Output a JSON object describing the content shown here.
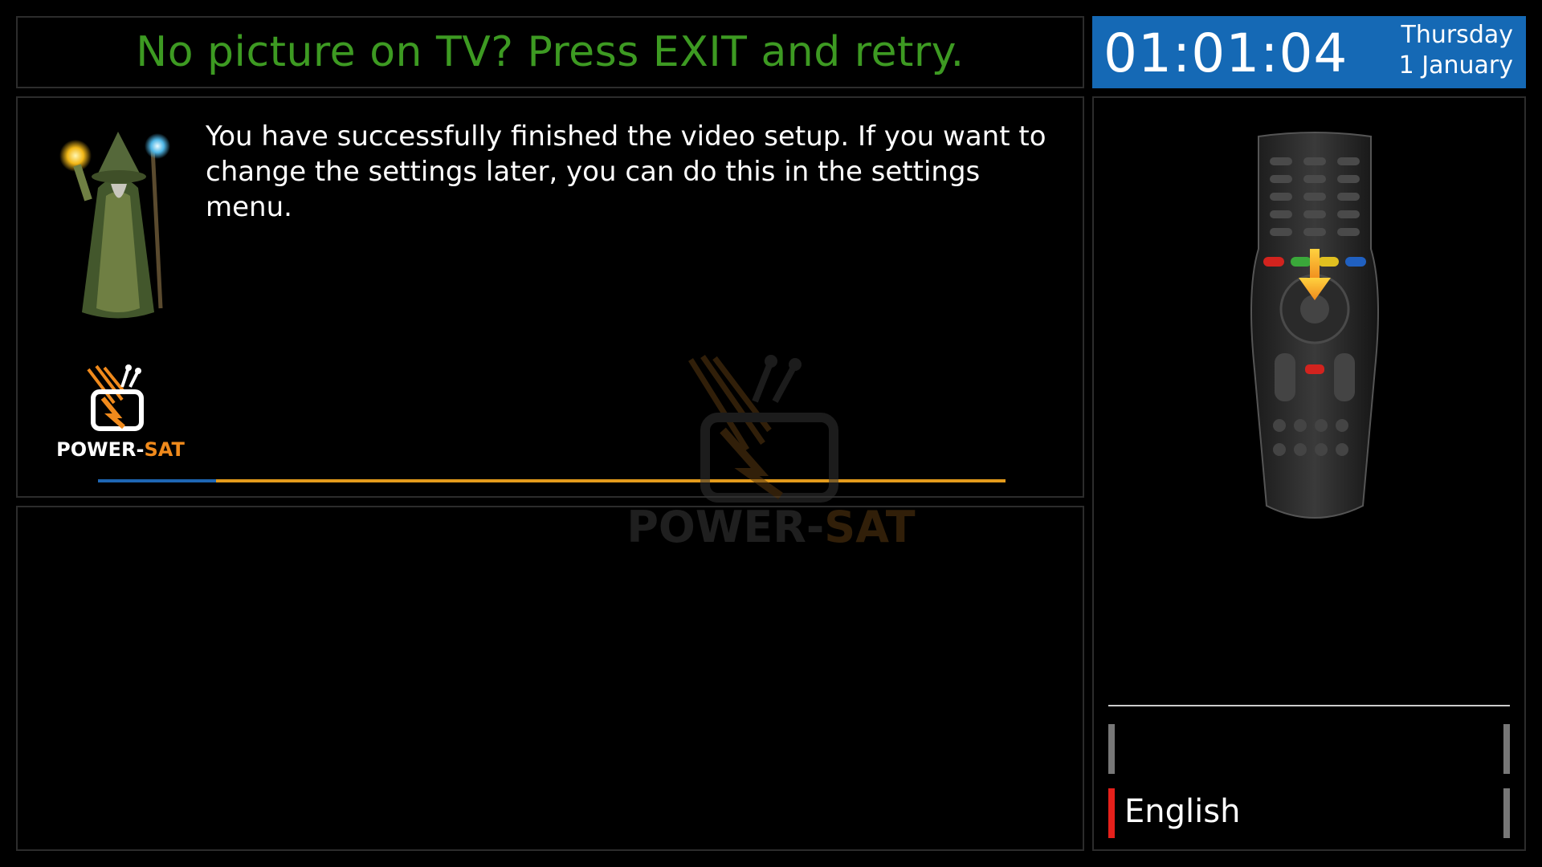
{
  "header": {
    "message": "No picture on TV? Press EXIT and retry.",
    "message_color": "#3d9a22"
  },
  "clock": {
    "time": "01:01:04",
    "day": "Thursday",
    "date": "1 January",
    "background": "#1569b5"
  },
  "wizard": {
    "text": "You have successfully finished the video setup. If you want to change the settings later, you can do this in the settings menu.",
    "progress_fraction": 0.13,
    "logo_text_white": "POWER-",
    "logo_text_accent": "SAT",
    "logo_accent_color": "#f08a1c"
  },
  "watermark": {
    "text_white": "POWER-",
    "text_accent": "SAT"
  },
  "language_list": {
    "items": [
      {
        "label": ""
      },
      {
        "label": "English"
      }
    ],
    "selected_index": 1
  },
  "icons": {
    "wizard": "wizard-figure-icon",
    "remote": "remote-control-icon",
    "logo": "power-sat-logo"
  }
}
